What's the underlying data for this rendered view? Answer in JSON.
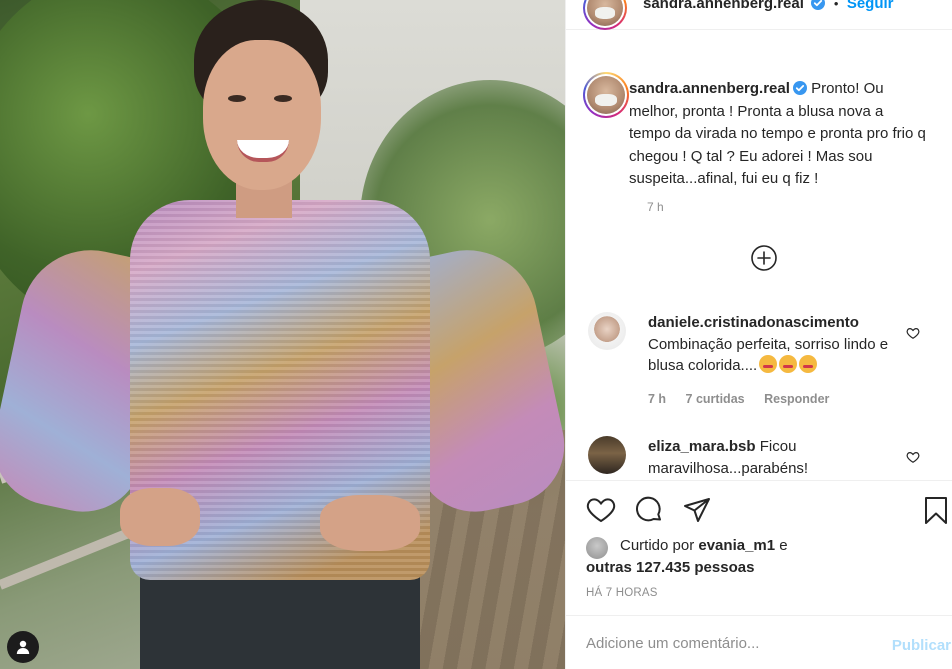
{
  "post": {
    "author": "sandra.annenberg.real",
    "follow_dot": "•",
    "follow_label": "Seguir",
    "caption": "Pronto! Ou melhor, pronta ! Pronta a blusa nova a tempo da virada no tempo e pronta pro frio q chegou ! Q tal ? Eu adorei ! Mas sou suspeita...afinal, fui eu q fiz !",
    "caption_time": "7 h"
  },
  "comments": [
    {
      "username": "daniele.cristinadonascimento",
      "text": "Combinação perfeita, sorriso lindo e blusa colorida....",
      "time": "7 h",
      "likes": "7 curtidas",
      "reply_label": "Responder"
    },
    {
      "username": "eliza_mara.bsb",
      "text": "Ficou maravilhosa...parabéns!"
    }
  ],
  "likes": {
    "prefix": "Curtido por",
    "liker": "evania_m1",
    "connector": "e",
    "others": "outras 127.435 pessoas"
  },
  "post_time": "HÁ 7 HORAS",
  "comment_box": {
    "placeholder": "Adicione um comentário...",
    "publish_label": "Publicar"
  },
  "colors": {
    "link_blue": "#0095f6",
    "publish_disabled": "#b2dffc",
    "muted": "#8e8e8e"
  },
  "icons": [
    "verified-badge-icon",
    "plus-circle-icon",
    "heart-icon",
    "comment-icon",
    "share-icon",
    "bookmark-icon",
    "user-tag-icon"
  ]
}
